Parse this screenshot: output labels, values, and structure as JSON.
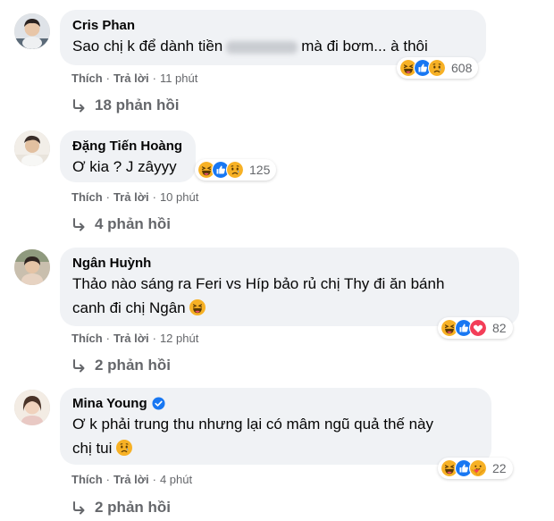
{
  "comments": [
    {
      "author": "Cris Phan",
      "text_before_blur": "Sao chị k để dành tiền",
      "text_after_blur": "mà đi bơm... à thôi",
      "reaction_count": "608",
      "like_label": "Thích",
      "reply_label": "Trả lời",
      "time": "11 phút",
      "replies_label": "18 phản hồi"
    },
    {
      "author": "Đặng Tiến Hoàng",
      "text": "Ơ kia ? J zâyyy",
      "reaction_count": "125",
      "like_label": "Thích",
      "reply_label": "Trả lời",
      "time": "10 phút",
      "replies_label": "4 phản hồi"
    },
    {
      "author": "Ngân Huỳnh",
      "text_line1": "Thảo nào sáng ra Feri vs Híp bảo rủ chị Thy đi ăn bánh",
      "text_line2": "canh đi chị Ngân",
      "reaction_count": "82",
      "like_label": "Thích",
      "reply_label": "Trả lời",
      "time": "12 phút",
      "replies_label": "2 phản hồi"
    },
    {
      "author": "Mina Young",
      "text_line1": "Ơ k phải trung thu nhưng lại có mâm ngũ quả thế này",
      "text_line2": "chị tui",
      "reaction_count": "22",
      "like_label": "Thích",
      "reply_label": "Trả lời",
      "time": "4 phút",
      "replies_label": "2 phản hồi"
    }
  ],
  "colors": {
    "bubble": "#f0f2f5",
    "secondary_text": "#65676b",
    "like_blue": "#1877f2",
    "haha_yellow": "#f7b125",
    "love_red": "#f33e58"
  }
}
